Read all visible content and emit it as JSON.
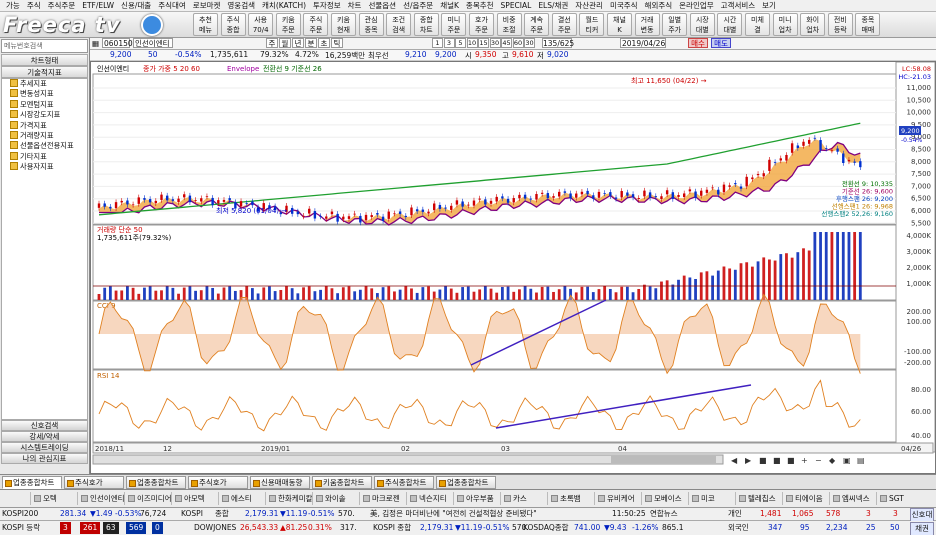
{
  "menu": [
    "가능",
    "주식",
    "주식주문",
    "ETF/ELW",
    "신용/대출",
    "주식대여",
    "로보마켓",
    "영웅검색",
    "캐치(KATCH)",
    "투자정보",
    "차트",
    "선물옵션",
    "선/옵주문",
    "채널K",
    "종목추천",
    "SPECIAL",
    "ELS/채권",
    "자산관리",
    "미국주식",
    "해외주식",
    "온라인업무",
    "고객서비스",
    "보기"
  ],
  "toolbar": [
    {
      "l1": "추천",
      "l2": "메뉴"
    },
    {
      "l1": "주식",
      "l2": "종합"
    },
    {
      "l1": "사용",
      "l2": "70/4"
    },
    {
      "l1": "키움",
      "l2": "주문"
    },
    {
      "l1": "주식",
      "l2": "주문"
    },
    {
      "l1": "키움",
      "l2": "현재"
    },
    {
      "l1": "관심",
      "l2": "종목"
    },
    {
      "l1": "조건",
      "l2": "검색"
    },
    {
      "l1": "종합",
      "l2": "차트"
    },
    {
      "l1": "미니",
      "l2": "주문"
    },
    {
      "l1": "호가",
      "l2": "주문"
    },
    {
      "l1": "비중",
      "l2": "조절"
    },
    {
      "l1": "계속",
      "l2": "주문"
    },
    {
      "l1": "결선",
      "l2": "주문"
    },
    {
      "l1": "월드",
      "l2": "티커"
    },
    {
      "l1": "채널",
      "l2": "K"
    },
    {
      "l1": "거래",
      "l2": "변동"
    },
    {
      "l1": "일별",
      "l2": "주가"
    },
    {
      "l1": "시장",
      "l2": "대별"
    },
    {
      "l1": "시간",
      "l2": "대별"
    },
    {
      "l1": "미체",
      "l2": "결"
    },
    {
      "l1": "미니",
      "l2": "업차"
    },
    {
      "l1": "화이",
      "l2": "업차"
    },
    {
      "l1": "전비",
      "l2": "등락"
    },
    {
      "l1": "종목",
      "l2": "매매"
    }
  ],
  "logo": "Freeca tv",
  "sidebar": {
    "search_placeholder": "메뉴번호검색",
    "header1": "차트형태",
    "header2": "기술적지표",
    "items": [
      "추세지표",
      "변동성지표",
      "모멘텀지표",
      "시장강도지표",
      "가격지표",
      "거래량지표",
      "선물옵션전용지표",
      "기타지표",
      "사용자지표"
    ],
    "bottom": [
      "신호검색",
      "강세/약세",
      "시스템트레이딩",
      "나의 관심지표"
    ]
  },
  "info": {
    "code": "060150",
    "name": "인선이엔티",
    "periods": [
      "주",
      "월",
      "년",
      "분",
      "초",
      "틱"
    ],
    "intervals": [
      "1",
      "3",
      "5",
      "10",
      "15",
      "30",
      "45",
      "60",
      "30"
    ],
    "count": "135",
    "count_total": "625",
    "date": "2019/04/26",
    "buy": "매수",
    "sell": "매도"
  },
  "quote": {
    "price": "9,200",
    "change": "50",
    "pct": "-0.54%",
    "volume": "1,735,611",
    "ratio": "79.32%",
    "ratio2": "4.72%",
    "amount_label": "16,259백만",
    "best_label": "최우선",
    "ask": "9,210",
    "bid": "9,200",
    "open_label": "시",
    "open": "9,350",
    "high_label": "고",
    "high": "9,610",
    "low_label": "저",
    "low": "9,020"
  },
  "legends": {
    "price": "인선이엔티",
    "ma": "종가 가중 5 20 60",
    "env": "Envelope",
    "ichimoku": "전환선 9 기준선 26",
    "volume": "거래량 단순 50",
    "volume_value": "1,735,611주(79.32%)",
    "cci": "CCI 9",
    "rsi": "RSI 14",
    "high_note": "최고 11,650 (04/22)",
    "low_note": "최저 5,820 (01/04)",
    "ichi_labels": [
      "전환선 9: 10,335",
      "기준선 26: 9,600",
      "후행스팬 26: 9,200",
      "선행스팬1 26: 9,968",
      "선행스팬2 52,26: 9,160"
    ],
    "corner": [
      "LC:58.08",
      "HC:-21.03"
    ],
    "current_price": "9,200",
    "current_pct": "-0.54%"
  },
  "chart_data": {
    "type": "candlestick",
    "x_labels": [
      "2018/11",
      "12",
      "2019/01",
      "02",
      "03",
      "04",
      "04/26"
    ],
    "price_axis": [
      "11,000",
      "10,500",
      "10,000",
      "9,500",
      "9,000",
      "8,500",
      "8,000",
      "7,500",
      "7,000",
      "6,500",
      "6,000",
      "5,500"
    ],
    "volume_axis": [
      "4,000K",
      "3,000K",
      "2,000K",
      "1,000K"
    ],
    "cci_axis": [
      "200.00",
      "100.00",
      "-100.00",
      "-200.00"
    ],
    "rsi_axis": [
      "80.00",
      "60.00",
      "40.00"
    ],
    "ylim_price": [
      5500,
      12000
    ]
  },
  "tabs": [
    "업종종합차트",
    "주식호가",
    "업종종합차트",
    "주식호가",
    "신용매매동향",
    "키움종합차트",
    "주식종합차트",
    "업종종합차트"
  ],
  "stocks": [
    "오텍",
    "인선이엔티",
    "이즈미디어",
    "아모텍",
    "에스티",
    "한화케미칼",
    "와이솔",
    "마크로젠",
    "넥슨지티",
    "아우부품",
    "카스",
    "초록뱀",
    "유비케어",
    "모베이스",
    "미코",
    "텔레칩스",
    "티에이음",
    "엠씨넥스",
    "SGT"
  ],
  "status1": {
    "kospi200": "KOSPI200",
    "kospi200_v": "281.34",
    "kospi200_c": "▼1.49",
    "kospi200_p": "-0.53%",
    "kospi200_vol": "76,724",
    "kospi": "KOSPI",
    "kospi_label": "종합",
    "kospi_v": "2,179.31",
    "kospi_c": "▼11.19",
    "kospi_p": "-0.51%",
    "kospi_vol": "570.",
    "news": "美, 김정은 마더비난에 \"여전히 건설적협상 준비됐다\"",
    "time": "11:50:25",
    "news_label": "연합뉴스",
    "gaein": "개인",
    "gaein_v": [
      "1,481",
      "1,065",
      "578",
      "3",
      "3"
    ],
    "waegook": "외국인",
    "waegook_v": [
      "347",
      "95",
      "2,234",
      "25",
      "50"
    ],
    "gigwan": "기관",
    "gigwan_v": [
      "1,844",
      "931",
      "635",
      "31",
      "3"
    ]
  },
  "status2": {
    "kospi": "KOSPI 등락",
    "k1": "3",
    "k2": "261",
    "k3": "63",
    "k4": "569",
    "k5": "0",
    "dow": "DOWJONES",
    "dow_v": "26,543.33",
    "dow_c": "▲81.25",
    "dow_p": "0.31%",
    "dow_vol": "317.",
    "kospi2": "KOSPI 종합",
    "kospi2_v": "2,179.31",
    "kospi2_c": "▼11.19",
    "kospi2_p": "-0.51%",
    "kospi2_vol": "570.",
    "kosdaq": "KOSDAQ종합",
    "kosdaq_v": "741.00",
    "kosdaq_c": "▼9.43",
    "kosdaq_p": "-1.26%",
    "kosdaq_vol": "865.1",
    "right1": "신호대",
    "right2": "채권"
  }
}
